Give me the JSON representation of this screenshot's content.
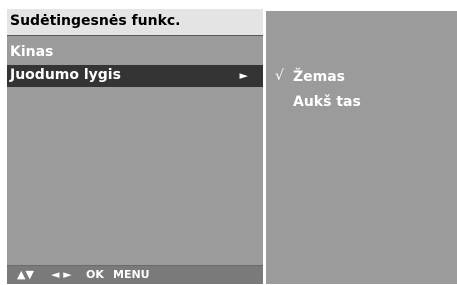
{
  "menu": {
    "title": "Sudėtingesnės funkc.",
    "items": [
      {
        "label": "Kinas",
        "selected": false
      },
      {
        "label": "Juodumo lygis",
        "selected": true,
        "submenu_arrow": "►"
      }
    ],
    "footer": {
      "up_down": "▲▼",
      "left_right": "◄ ►",
      "ok": "OK",
      "menu": "MENU"
    }
  },
  "options": {
    "items": [
      {
        "check": "√",
        "label": "Žemas",
        "checked": true
      },
      {
        "check": "",
        "label": "Aukš tas",
        "checked": false
      }
    ]
  },
  "colors": {
    "panel": "#9b9b9b",
    "title_bar": "#e4e4e4",
    "highlight": "#343434",
    "text": "#ffffff"
  }
}
